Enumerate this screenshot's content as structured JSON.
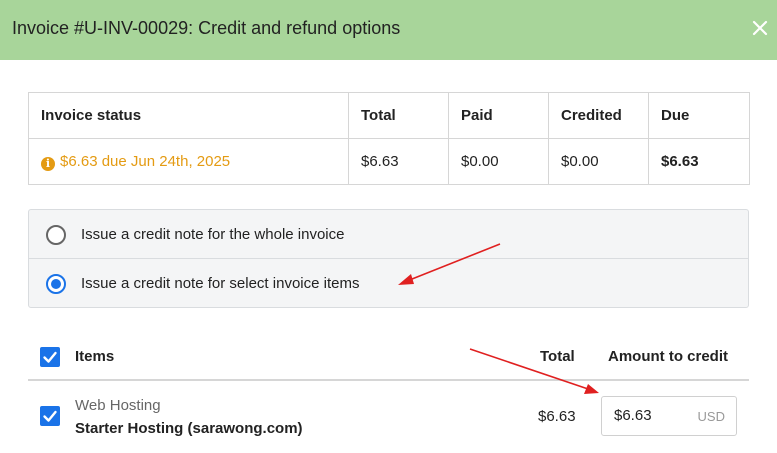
{
  "header": {
    "title": "Invoice #U-INV-00029: Credit and refund options",
    "bg_color": "#a8d59a"
  },
  "status_table": {
    "headers": [
      "Invoice status",
      "Total",
      "Paid",
      "Credited",
      "Due"
    ],
    "row": {
      "status": "$6.63 due Jun 24th, 2025",
      "total": "$6.63",
      "paid": "$0.00",
      "credited": "$0.00",
      "due": "$6.63"
    },
    "status_icon": "info-icon",
    "due_color": "#e49b13"
  },
  "credit_options": [
    {
      "label": "Issue a credit note for the whole invoice",
      "selected": false
    },
    {
      "label": "Issue a credit note for select invoice items",
      "selected": true
    }
  ],
  "items": {
    "headers": {
      "items": "Items",
      "total": "Total",
      "amount": "Amount to credit"
    },
    "select_all_checked": true,
    "rows": [
      {
        "name": "Web Hosting",
        "description": "Starter Hosting (sarawong.com)",
        "total": "$6.63",
        "amount_value": "$6.63",
        "currency": "USD",
        "checked": true
      }
    ]
  },
  "accent_color": "#1a73e8",
  "annotation_color": "#e02020"
}
